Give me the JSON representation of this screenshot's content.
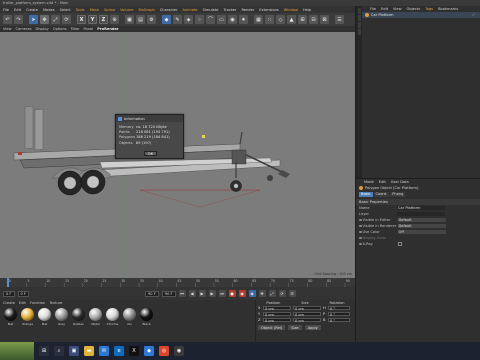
{
  "title_bar": {
    "text": "trailer_platform_system.c4d * - Main"
  },
  "menu": {
    "items": [
      "File",
      "Edit",
      "Create",
      "Modes",
      "Select",
      "Tools",
      "Mesh",
      "Spline",
      "Volume",
      "MoGraph",
      "Character",
      "Animate",
      "Simulate",
      "Tracker",
      "Render",
      "Extensions",
      "Window",
      "Help"
    ]
  },
  "toolbar": {
    "x": "X",
    "y": "Y",
    "z": "Z"
  },
  "view_menu": {
    "items": [
      "View",
      "Cameras",
      "Display",
      "Options",
      "Filter",
      "Panel",
      "ProRender"
    ]
  },
  "viewport": {
    "grid_spacing": "Grid Spacing : 100 cm"
  },
  "info_dialog": {
    "title": "Information",
    "rows": [
      {
        "key": "Memory",
        "value": "ca. 18 720 KByte"
      },
      {
        "key": "Points",
        "value": "218 061 (193 791)"
      },
      {
        "key": "Polygons",
        "value": "186 219 (184 841)"
      },
      {
        "key": "Objects",
        "value": "89 (197)"
      }
    ],
    "ok_label": "OK"
  },
  "timeline": {
    "ticks": [
      "0",
      "5",
      "10",
      "15",
      "20",
      "25",
      "30",
      "35",
      "40",
      "45",
      "50",
      "55",
      "60",
      "65",
      "70",
      "75",
      "80",
      "85",
      "90"
    ],
    "frame_end_label": "0 F"
  },
  "playbar": {
    "start": "0 F",
    "current": "0 F",
    "end": "90 F",
    "end2": "90 F"
  },
  "materials": {
    "menu": [
      "Create",
      "Edit",
      "Function",
      "Texture"
    ],
    "items": [
      {
        "name": "Mat",
        "color": "#1a1a1a"
      },
      {
        "name": "Orange",
        "color": "#e8b23a"
      },
      {
        "name": "Mat",
        "color": "#dcdcdc"
      },
      {
        "name": "Grey",
        "color": "#9a9a9a"
      },
      {
        "name": "Rubber",
        "color": "#2a2a2a"
      },
      {
        "name": "Metal",
        "color": "#b0b0b0"
      },
      {
        "name": "Chrome",
        "color": "#d6d6d6"
      },
      {
        "name": "Alu",
        "color": "#8c8c8c"
      },
      {
        "name": "Black",
        "color": "#111111"
      }
    ]
  },
  "coordinates": {
    "headers": [
      "Position",
      "Size",
      "Rotation"
    ],
    "rows": [
      {
        "axis": "X",
        "p": "0 cm",
        "s": "0 cm",
        "rl": "H",
        "r": "0 °"
      },
      {
        "axis": "Y",
        "p": "0 cm",
        "s": "0 cm",
        "rl": "P",
        "r": "0 °"
      },
      {
        "axis": "Z",
        "p": "0 cm",
        "s": "0 cm",
        "rl": "B",
        "r": "0 °"
      }
    ],
    "mode": "Object (Rel)",
    "size_mode": "Size",
    "apply": "Apply"
  },
  "object_manager": {
    "menu": [
      "File",
      "Edit",
      "View",
      "Objects",
      "Tags",
      "Bookmarks"
    ],
    "object_name": "Car Platform"
  },
  "attribute_manager": {
    "menu": [
      "Mode",
      "Edit",
      "User Data"
    ],
    "object_line": "Polygon Object [Car Platform]",
    "tabs": [
      "Basic",
      "Coord.",
      "Phong"
    ],
    "section": "Basic Properties",
    "rows": [
      {
        "label": "Name",
        "value": "Car Platform"
      },
      {
        "label": "Layer",
        "value": ""
      },
      {
        "label": "Visible in Editor",
        "value": "Default"
      },
      {
        "label": "Visible in Renderer",
        "value": "Default"
      },
      {
        "label": "Use Color",
        "value": "Off"
      },
      {
        "label": "Display Color",
        "value": ""
      },
      {
        "label": "X-Ray",
        "value": ""
      }
    ]
  },
  "colors": {
    "accent": "#e8a23a",
    "blue": "#3f6aa6",
    "render_red": "#b63a2e"
  }
}
